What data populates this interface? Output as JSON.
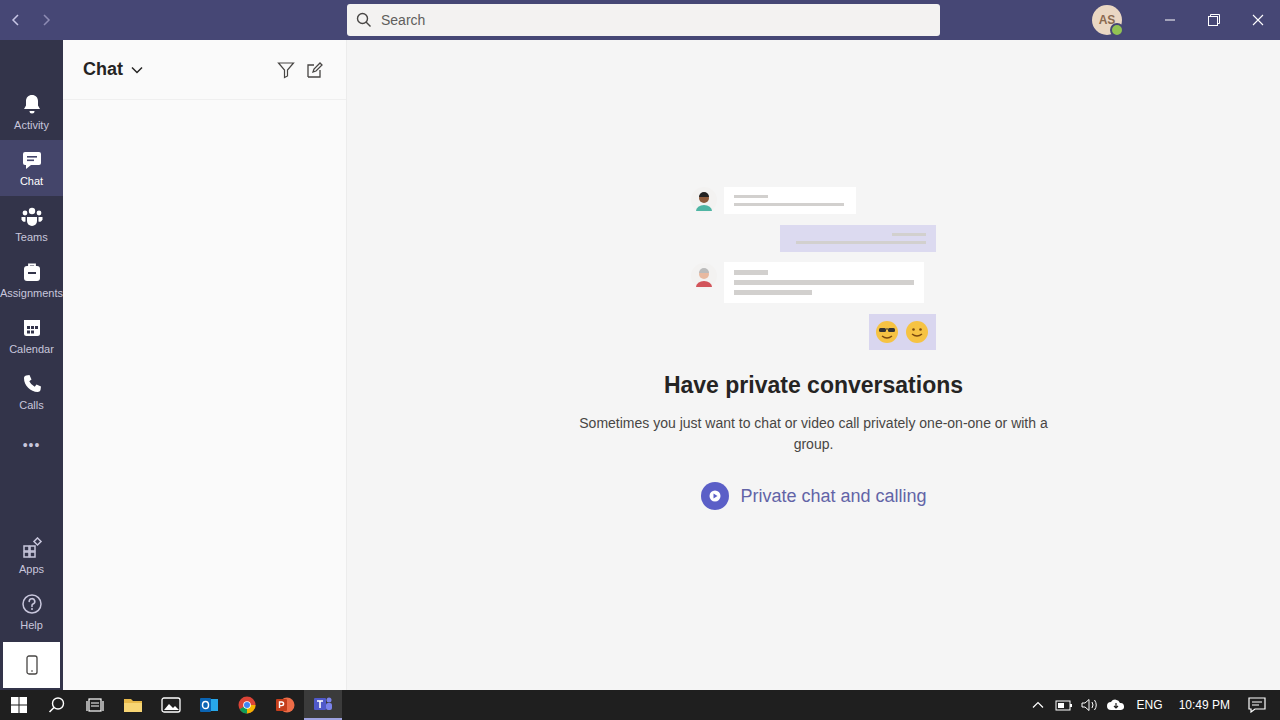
{
  "titlebar": {
    "search": {
      "placeholder": "Search"
    },
    "avatar": {
      "initials": "AS",
      "status_color": "#92c353"
    }
  },
  "rail": {
    "items": [
      {
        "label": "Activity",
        "kind": "activity",
        "selected": false
      },
      {
        "label": "Chat",
        "kind": "chat",
        "selected": true
      },
      {
        "label": "Teams",
        "kind": "teams",
        "selected": false
      },
      {
        "label": "Assignments",
        "kind": "assignments",
        "selected": false
      },
      {
        "label": "Calendar",
        "kind": "calendar",
        "selected": false
      },
      {
        "label": "Calls",
        "kind": "calls",
        "selected": false
      }
    ],
    "more": "•••",
    "bottom_items": [
      {
        "label": "Apps",
        "kind": "apps",
        "selected": false
      },
      {
        "label": "Help",
        "kind": "help",
        "selected": false
      }
    ],
    "mobile_button": {
      "selected": true
    }
  },
  "chat_panel": {
    "title": "Chat"
  },
  "empty_state": {
    "heading": "Have private conversations",
    "text": "Sometimes you just want to chat or video call privately one-on-one or with a group.",
    "link": "Private chat and calling"
  },
  "taskbar": {
    "apps": [
      {
        "kind": "start",
        "selected": false
      },
      {
        "kind": "search",
        "selected": false
      },
      {
        "kind": "taskview",
        "selected": false
      },
      {
        "kind": "explorer",
        "selected": false
      },
      {
        "kind": "photos",
        "selected": false
      },
      {
        "kind": "outlook",
        "selected": false
      },
      {
        "kind": "chrome",
        "selected": false
      },
      {
        "kind": "powerpoint",
        "selected": false
      },
      {
        "kind": "teams",
        "selected": true
      }
    ],
    "tray": {
      "language": "ENG",
      "time": "10:49 PM"
    }
  }
}
